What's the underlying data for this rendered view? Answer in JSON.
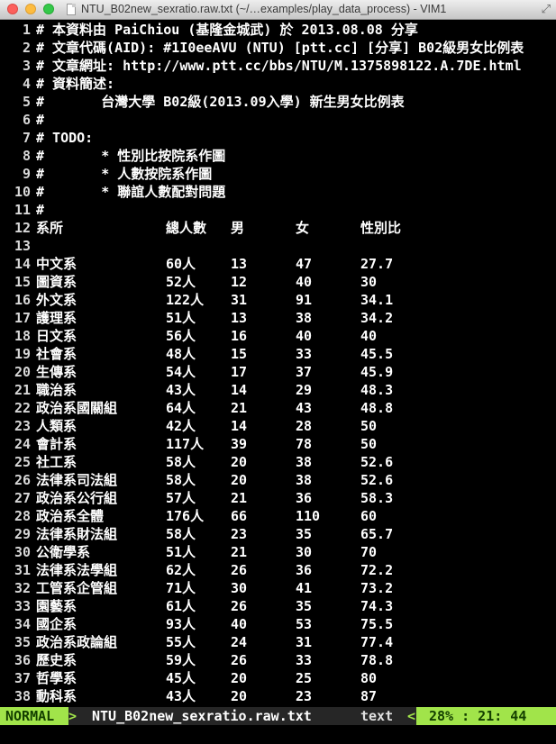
{
  "window": {
    "title": "NTU_B02new_sexratio.raw.txt (~/…examples/play_data_process) - VIM1"
  },
  "buffer_lines": [
    {
      "n": "1",
      "text": "# 本資料由 PaiChiou (基隆金城武) 於 2013.08.08 分享"
    },
    {
      "n": "2",
      "text": "# 文章代碼(AID): #1I0eeAVU (NTU) [ptt.cc] [分享] B02級男女比例表"
    },
    {
      "n": "3",
      "text": "# 文章網址: http://www.ptt.cc/bbs/NTU/M.1375898122.A.7DE.html"
    },
    {
      "n": "4",
      "text": "# 資料簡述:"
    },
    {
      "n": "5",
      "text": "#       台灣大學 B02級(2013.09入學) 新生男女比例表"
    },
    {
      "n": "6",
      "text": "#"
    },
    {
      "n": "7",
      "text": "# TODO:"
    },
    {
      "n": "8",
      "text": "#       * 性別比按院系作圖"
    },
    {
      "n": "9",
      "text": "#       * 人數按院系作圖"
    },
    {
      "n": "10",
      "text": "#       * 聯誼人數配對問題"
    },
    {
      "n": "11",
      "text": "#"
    }
  ],
  "table": {
    "header": {
      "n": "12",
      "dept": "系所",
      "total": "總人數",
      "male": "男",
      "female": "女",
      "ratio": "性別比"
    },
    "blank_line": "13",
    "rows": [
      {
        "n": "14",
        "dept": "中文系",
        "total": "60人",
        "male": "13",
        "female": "47",
        "ratio": "27.7"
      },
      {
        "n": "15",
        "dept": "圖資系",
        "total": "52人",
        "male": "12",
        "female": "40",
        "ratio": "30"
      },
      {
        "n": "16",
        "dept": "外文系",
        "total": "122人",
        "male": "31",
        "female": "91",
        "ratio": "34.1"
      },
      {
        "n": "17",
        "dept": "護理系",
        "total": "51人",
        "male": "13",
        "female": "38",
        "ratio": "34.2"
      },
      {
        "n": "18",
        "dept": "日文系",
        "total": "56人",
        "male": "16",
        "female": "40",
        "ratio": "40"
      },
      {
        "n": "19",
        "dept": "社會系",
        "total": "48人",
        "male": "15",
        "female": "33",
        "ratio": "45.5"
      },
      {
        "n": "20",
        "dept": "生傳系",
        "total": "54人",
        "male": "17",
        "female": "37",
        "ratio": "45.9"
      },
      {
        "n": "21",
        "dept": "職治系",
        "total": "43人",
        "male": "14",
        "female": "29",
        "ratio": "48.3"
      },
      {
        "n": "22",
        "dept": "政治系國關組",
        "total": "64人",
        "male": "21",
        "female": "43",
        "ratio": "48.8"
      },
      {
        "n": "23",
        "dept": "人類系",
        "total": "42人",
        "male": "14",
        "female": "28",
        "ratio": "50"
      },
      {
        "n": "24",
        "dept": "會計系",
        "total": "117人",
        "male": "39",
        "female": "78",
        "ratio": "50"
      },
      {
        "n": "25",
        "dept": "社工系",
        "total": "58人",
        "male": "20",
        "female": "38",
        "ratio": "52.6"
      },
      {
        "n": "26",
        "dept": "法律系司法組",
        "total": "58人",
        "male": "20",
        "female": "38",
        "ratio": "52.6"
      },
      {
        "n": "27",
        "dept": "政治系公行組",
        "total": "57人",
        "male": "21",
        "female": "36",
        "ratio": "58.3"
      },
      {
        "n": "28",
        "dept": "政治系全體",
        "total": "176人",
        "male": "66",
        "female": "110",
        "ratio": "60"
      },
      {
        "n": "29",
        "dept": "法律系財法組",
        "total": "58人",
        "male": "23",
        "female": "35",
        "ratio": "65.7"
      },
      {
        "n": "30",
        "dept": "公衛學系",
        "total": "51人",
        "male": "21",
        "female": "30",
        "ratio": "70"
      },
      {
        "n": "31",
        "dept": "法律系法學組",
        "total": "62人",
        "male": "26",
        "female": "36",
        "ratio": "72.2"
      },
      {
        "n": "32",
        "dept": "工管系企管組",
        "total": "71人",
        "male": "30",
        "female": "41",
        "ratio": "73.2"
      },
      {
        "n": "33",
        "dept": "園藝系",
        "total": "61人",
        "male": "26",
        "female": "35",
        "ratio": "74.3"
      },
      {
        "n": "34",
        "dept": "國企系",
        "total": "93人",
        "male": "40",
        "female": "53",
        "ratio": "75.5"
      },
      {
        "n": "35",
        "dept": "政治系政論組",
        "total": "55人",
        "male": "24",
        "female": "31",
        "ratio": "77.4"
      },
      {
        "n": "36",
        "dept": "歷史系",
        "total": "59人",
        "male": "26",
        "female": "33",
        "ratio": "78.8"
      },
      {
        "n": "37",
        "dept": "哲學系",
        "total": "45人",
        "male": "20",
        "female": "25",
        "ratio": "80"
      },
      {
        "n": "38",
        "dept": "動科系",
        "total": "43人",
        "male": "20",
        "female": "23",
        "ratio": "87"
      }
    ]
  },
  "statusline": {
    "mode": "NORMAL",
    "filename": "NTU_B02new_sexratio.raw.txt",
    "filetype": "text",
    "position": "28% :  21: 44"
  },
  "colors": {
    "accent": "#a1e44a",
    "background": "#000000",
    "text": "#ffffff"
  }
}
